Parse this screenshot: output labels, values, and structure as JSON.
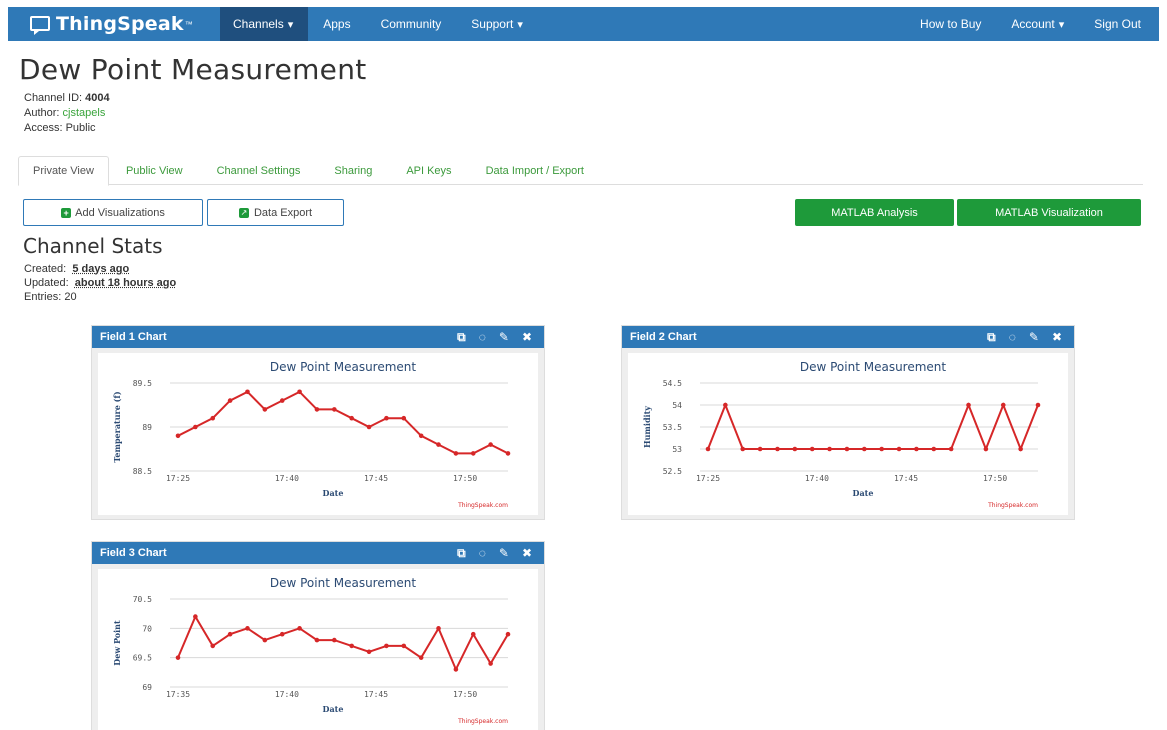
{
  "nav": {
    "brand": "ThingSpeak",
    "brand_tm": "™",
    "left_items": [
      "Channels",
      "Apps",
      "Community",
      "Support"
    ],
    "right_items": [
      "How to Buy",
      "Account",
      "Sign Out"
    ]
  },
  "page": {
    "title": "Dew Point Measurement",
    "channel_id_label": "Channel ID:",
    "channel_id": "4004",
    "author_label": "Author:",
    "author": "cjstapels",
    "access_label": "Access:",
    "access": "Public"
  },
  "tabs": [
    "Private View",
    "Public View",
    "Channel Settings",
    "Sharing",
    "API Keys",
    "Data Import / Export"
  ],
  "buttons": {
    "add_visualizations": "Add Visualizations",
    "data_export": "Data Export",
    "matlab_analysis": "MATLAB Analysis",
    "matlab_visualization": "MATLAB Visualization"
  },
  "stats": {
    "title": "Channel Stats",
    "created_label": "Created:",
    "created": "5 days ago",
    "updated_label": "Updated:",
    "updated": "about 18 hours ago",
    "entries_label": "Entries:",
    "entries": "20"
  },
  "colors": {
    "nav": "#2f79b7",
    "accent_green": "#1e9a3a",
    "series": "#d62728"
  },
  "icons": [
    "chat-icon",
    "plus-icon",
    "export-icon",
    "popout-icon",
    "comment-icon",
    "pencil-icon",
    "close-icon"
  ],
  "chart_data": [
    {
      "type": "line",
      "panel_title": "Field 1 Chart",
      "title": "Dew Point Measurement",
      "xlabel": "Date",
      "ylabel": "Temperature (f)",
      "credit": "ThingSpeak.com",
      "x_ticks": [
        "17:25",
        "17:40",
        "17:45",
        "17:50"
      ],
      "y_ticks": [
        "88.5",
        "89",
        "89.5"
      ],
      "ylim": [
        88.5,
        89.5
      ],
      "series": [
        {
          "values": [
            88.9,
            89.0,
            89.1,
            89.3,
            89.4,
            89.2,
            89.3,
            89.4,
            89.2,
            89.2,
            89.1,
            89.0,
            89.1,
            89.1,
            88.9,
            88.8,
            88.7,
            88.7,
            88.8,
            88.7
          ]
        }
      ]
    },
    {
      "type": "line",
      "panel_title": "Field 2 Chart",
      "title": "Dew Point Measurement",
      "xlabel": "Date",
      "ylabel": "Humidity",
      "credit": "ThingSpeak.com",
      "x_ticks": [
        "17:25",
        "17:40",
        "17:45",
        "17:50"
      ],
      "y_ticks": [
        "52.5",
        "53",
        "53.5",
        "54",
        "54.5"
      ],
      "ylim": [
        52.5,
        54.5
      ],
      "series": [
        {
          "values": [
            53,
            54,
            53,
            53,
            53,
            53,
            53,
            53,
            53,
            53,
            53,
            53,
            53,
            53,
            53,
            54,
            53,
            54,
            53,
            54
          ]
        }
      ]
    },
    {
      "type": "line",
      "panel_title": "Field 3 Chart",
      "title": "Dew Point Measurement",
      "xlabel": "Date",
      "ylabel": "Dew Point",
      "credit": "ThingSpeak.com",
      "x_ticks": [
        "17:35",
        "17:40",
        "17:45",
        "17:50"
      ],
      "y_ticks": [
        "69",
        "69.5",
        "70",
        "70.5"
      ],
      "ylim": [
        69,
        70.5
      ],
      "series": [
        {
          "values": [
            69.5,
            70.2,
            69.7,
            69.9,
            70.0,
            69.8,
            69.9,
            70.0,
            69.8,
            69.8,
            69.7,
            69.6,
            69.7,
            69.7,
            69.5,
            70.0,
            69.3,
            69.9,
            69.4,
            69.9
          ]
        }
      ]
    }
  ]
}
